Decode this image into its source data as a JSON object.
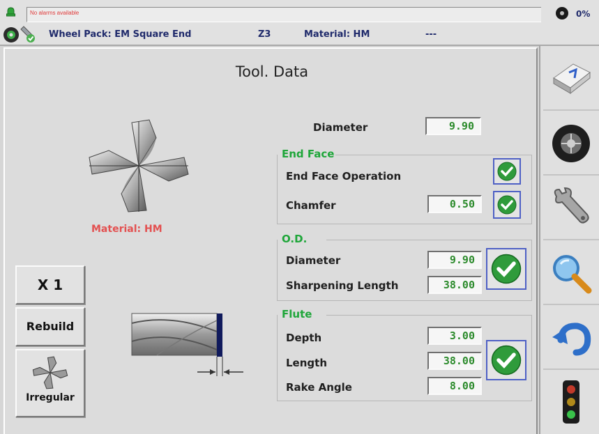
{
  "header": {
    "alarm_text": "No alarms available",
    "progress_percent": "0%",
    "wheel_pack": "Wheel Pack: EM Square End",
    "z_value": "Z3",
    "material": "Material: HM",
    "extra": "---"
  },
  "main": {
    "title": "Tool. Data",
    "material_label": "Material: HM",
    "diameter": {
      "label": "Diameter",
      "value": "9.90"
    },
    "end_face": {
      "title": "End Face",
      "operation_label": "End Face Operation",
      "chamfer_label": "Chamfer",
      "chamfer_value": "0.50"
    },
    "od": {
      "title": "O.D.",
      "diameter_label": "Diameter",
      "diameter_value": "9.90",
      "sharpening_label": "Sharpening Length",
      "sharpening_value": "38.00"
    },
    "flute": {
      "title": "Flute",
      "depth_label": "Depth",
      "depth_value": "3.00",
      "length_label": "Length",
      "length_value": "38.00",
      "rake_label": "Rake Angle",
      "rake_value": "8.00"
    },
    "buttons": {
      "multiplier": "X 1",
      "rebuild": "Rebuild",
      "irregular": "Irregular"
    }
  },
  "toolbar_icons": [
    "keyboard-key-icon",
    "wheel-icon",
    "wrench-icon",
    "magnifier-icon",
    "undo-icon",
    "traffic-light-icon"
  ],
  "colors": {
    "value_green": "#2b8a2b",
    "group_title_green": "#1fa63a",
    "material_red": "#e35050",
    "header_blue": "#1f2a6b",
    "check_green": "#2f9b3b"
  }
}
